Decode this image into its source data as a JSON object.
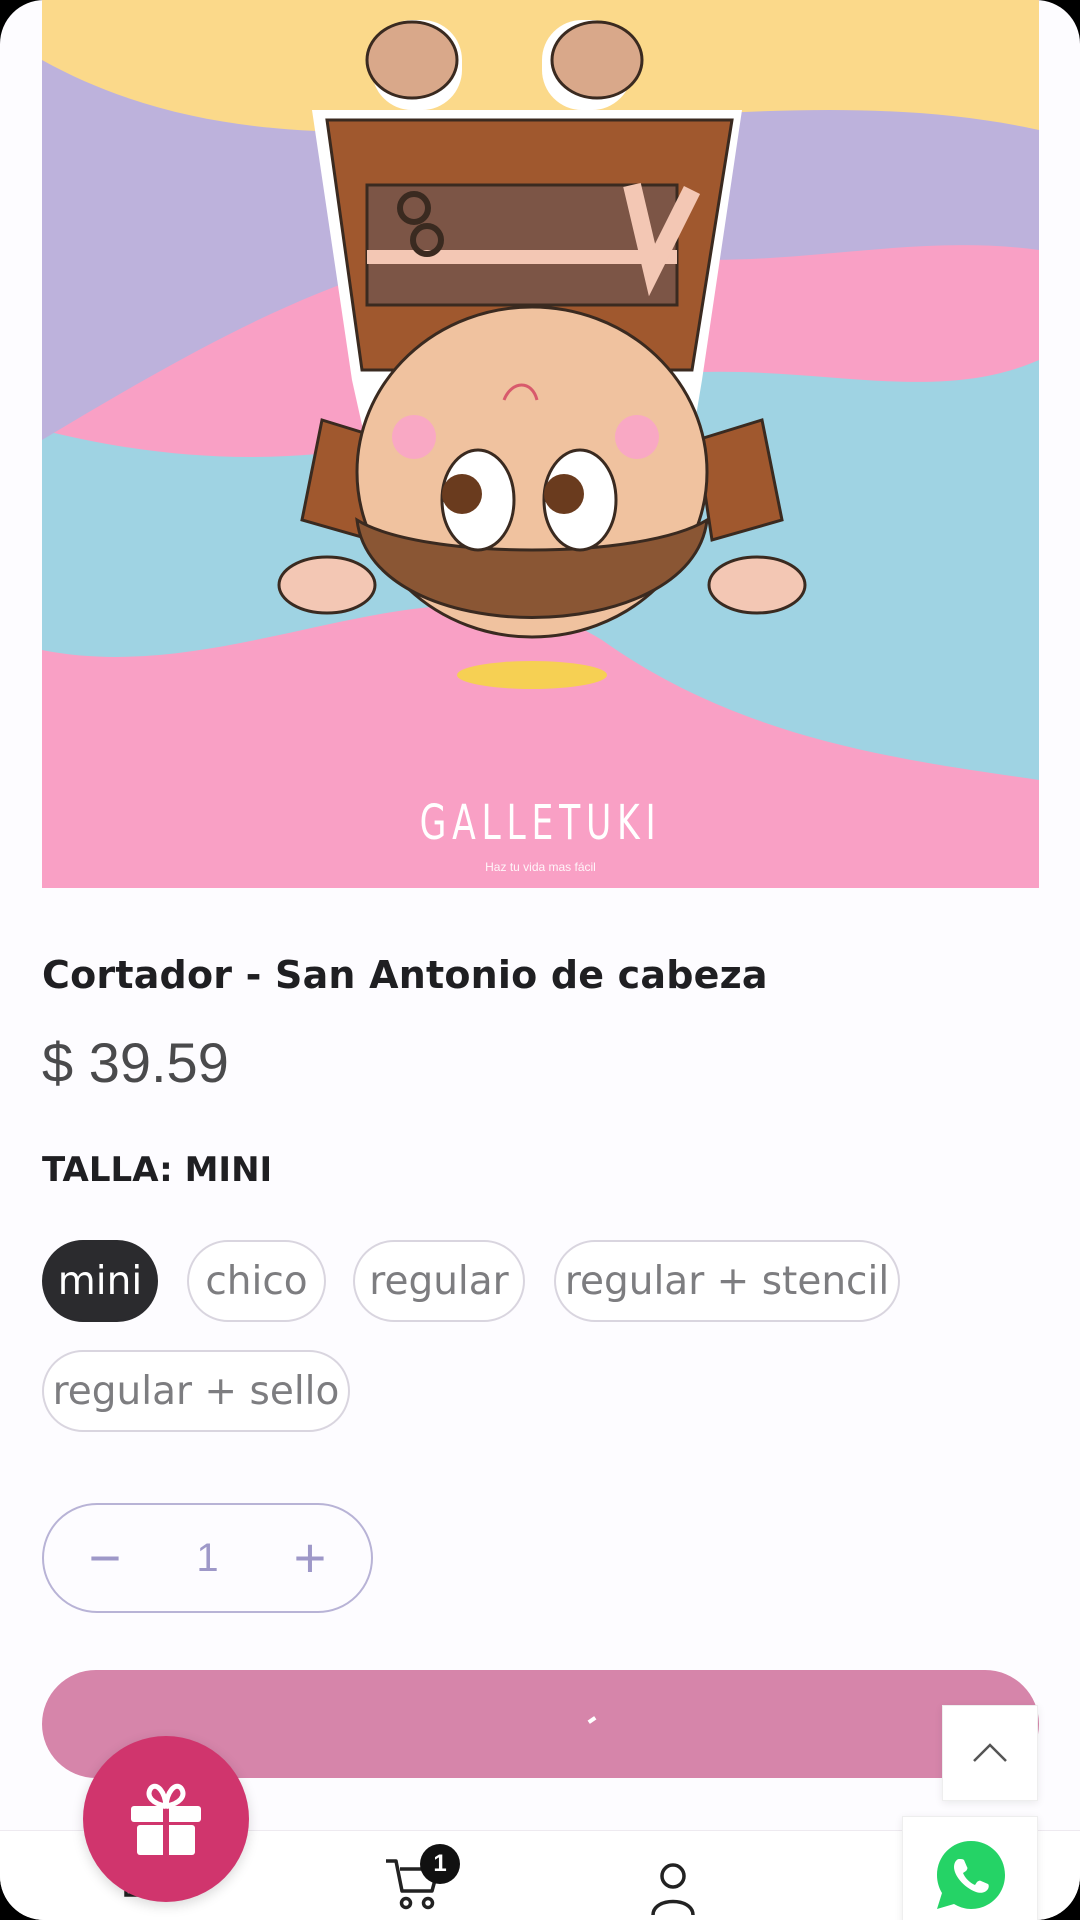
{
  "product": {
    "brand": "GALLETUKI",
    "tagline": "Haz tu vida mas fácil",
    "title": "Cortador - San Antonio de cabeza",
    "price": "$ 39.59",
    "size_label_prefix": "TALLA:",
    "size_label_value": "MINI",
    "sizes": [
      "mini",
      "chico",
      "regular",
      "regular + stencil",
      "regular + sello"
    ],
    "selected_size": "mini",
    "quantity": "1"
  },
  "cart": {
    "badge_count": "1"
  },
  "colors": {
    "accent_pink": "#d685aa",
    "gift_button": "#d0356d",
    "selected_chip": "#2b2b2e",
    "qty_outline": "#b8b3d6",
    "whatsapp_green": "#25d366"
  },
  "icons": {
    "gift": "gift-icon",
    "scroll_top": "chevron-up-icon",
    "home": "home-icon",
    "cart": "cart-icon",
    "account": "user-icon",
    "whatsapp": "whatsapp-icon"
  }
}
